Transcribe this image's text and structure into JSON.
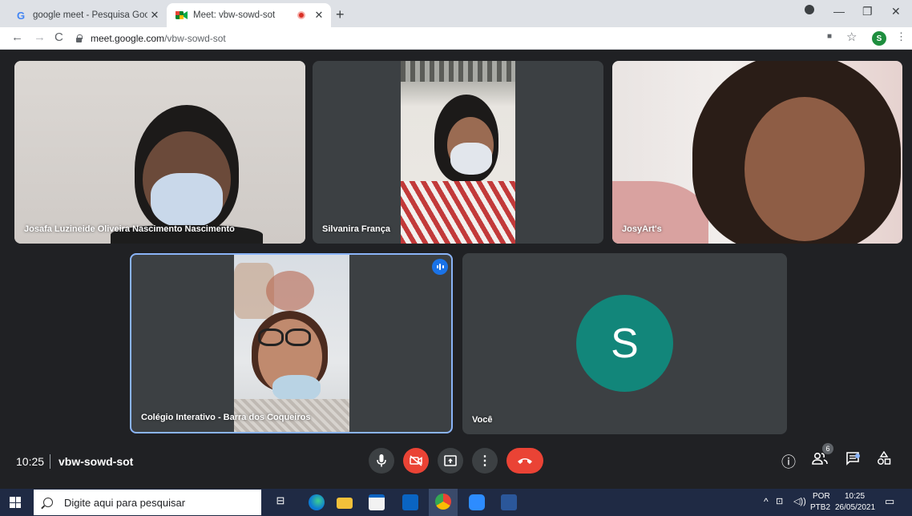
{
  "browser": {
    "tabs": [
      {
        "title": "google meet - Pesquisa Google",
        "favicon": "google-icon",
        "active": false
      },
      {
        "title": "Meet: vbw-sowd-sot",
        "favicon": "meet-icon",
        "active": true,
        "recording": true
      }
    ],
    "url_host": "meet.google.com",
    "url_path": "/vbw-sowd-sot",
    "profile_initial": "S"
  },
  "meeting": {
    "participants": [
      {
        "name": "Josafa Luzineide Oliveira Nascimento Nascimento"
      },
      {
        "name": "Silvanira França"
      },
      {
        "name": "JosyArt's"
      },
      {
        "name": "Colégio Interativo - Barra dos Coqueiros",
        "speaking": true
      },
      {
        "name": "Você",
        "avatar_initial": "S",
        "avatar_color": "#12867a"
      }
    ],
    "time": "10:25",
    "code": "vbw-sowd-sot",
    "people_count": "6",
    "colors": {
      "hangup": "#ea4335",
      "camera_off": "#ea4335",
      "accent": "#1a73e8"
    }
  },
  "taskbar": {
    "search_placeholder": "Digite aqui para pesquisar",
    "lang_top": "POR",
    "lang_bottom": "PTB2",
    "time": "10:25",
    "date": "26/05/2021"
  }
}
